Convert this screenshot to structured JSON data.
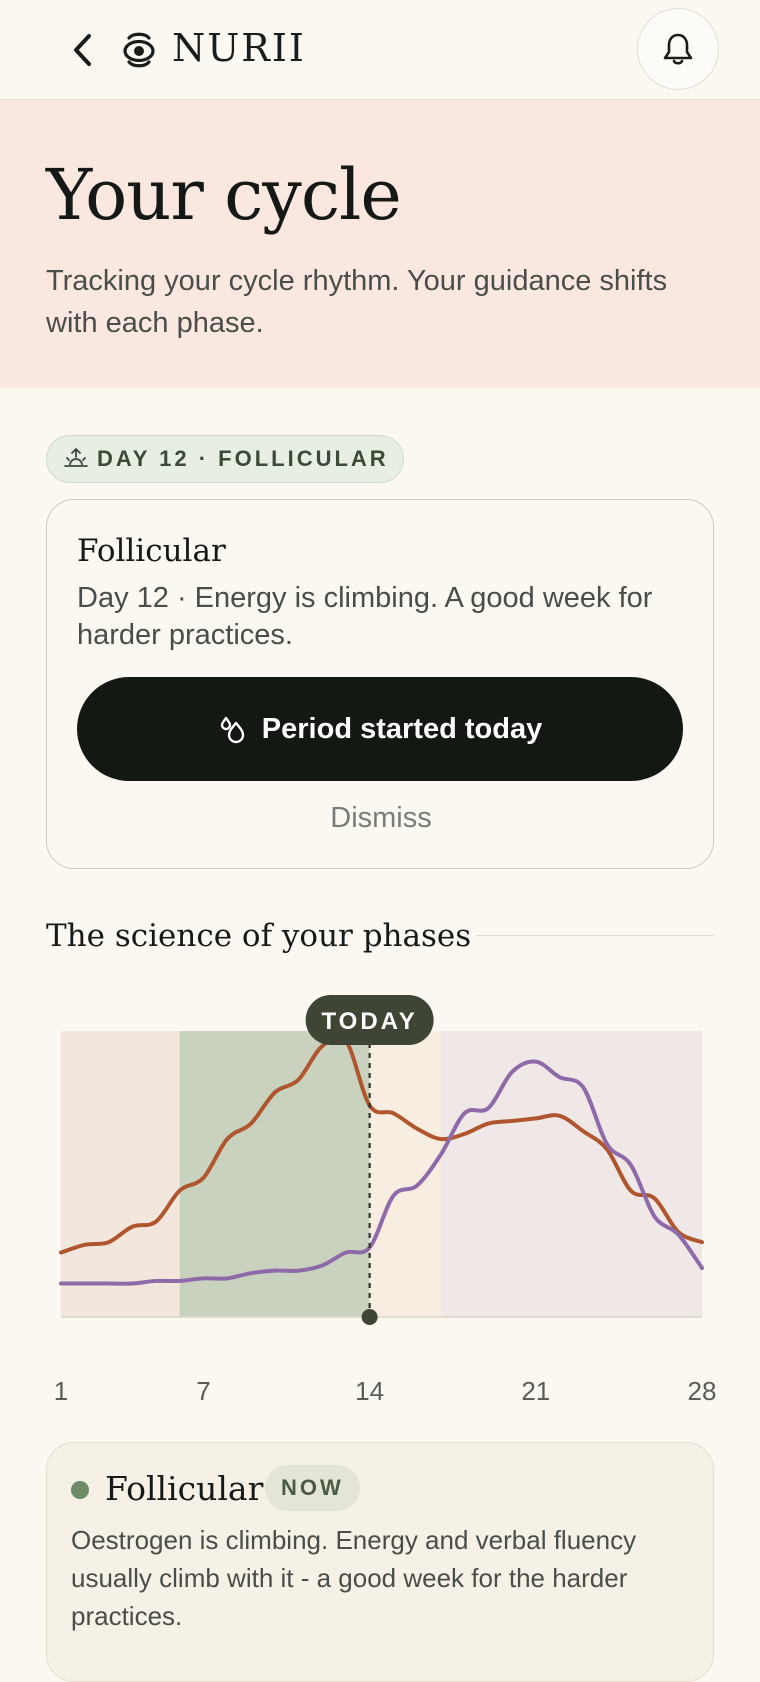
{
  "header": {
    "brand": "NURII"
  },
  "hero": {
    "title": "Your cycle",
    "subtitle": "Tracking your cycle rhythm. Your guidance shifts with each phase."
  },
  "status_pill": "DAY 12 · FOLLICULAR",
  "phase_card": {
    "title": "Follicular",
    "description": "Day 12 · Energy is climbing. A good week for harder practices.",
    "cta_label": "Period started today",
    "dismiss_label": "Dismiss"
  },
  "science": {
    "title": "The science of your phases"
  },
  "chart_data": {
    "type": "line",
    "today_label": "TODAY",
    "today_day": 14,
    "x_ticks": [
      "1",
      "7",
      "14",
      "21",
      "28"
    ],
    "xlim": [
      1,
      28
    ],
    "colors": {
      "series_1": "#b0562e",
      "series_2": "#8f6aa8",
      "today_bg": "#3f4535"
    },
    "phases": [
      {
        "start": 1,
        "end": 6,
        "color": "#f2e6dd"
      },
      {
        "start": 6,
        "end": 14,
        "color": "#c9d1bf"
      },
      {
        "start": 14,
        "end": 17,
        "color": "#f7ede0"
      },
      {
        "start": 17,
        "end": 28,
        "color": "#efe8e6"
      }
    ],
    "series": [
      {
        "x": [
          1,
          2,
          3,
          4,
          5,
          6,
          7,
          8,
          9,
          10,
          11,
          12,
          13,
          14,
          15,
          16,
          17,
          18,
          19,
          20,
          21,
          22,
          23,
          24,
          25,
          26,
          27,
          28
        ],
        "values": [
          0.18,
          0.21,
          0.22,
          0.28,
          0.3,
          0.42,
          0.47,
          0.62,
          0.68,
          0.8,
          0.85,
          0.98,
          1.0,
          0.75,
          0.72,
          0.66,
          0.62,
          0.64,
          0.68,
          0.69,
          0.7,
          0.71,
          0.65,
          0.58,
          0.42,
          0.39,
          0.26,
          0.22
        ]
      },
      {
        "x": [
          1,
          2,
          3,
          4,
          5,
          6,
          7,
          8,
          9,
          10,
          11,
          12,
          13,
          14,
          15,
          16,
          17,
          18,
          19,
          20,
          21,
          22,
          23,
          24,
          25,
          26,
          27,
          28
        ],
        "values": [
          0.06,
          0.06,
          0.06,
          0.06,
          0.07,
          0.07,
          0.08,
          0.08,
          0.1,
          0.11,
          0.11,
          0.13,
          0.18,
          0.2,
          0.4,
          0.44,
          0.56,
          0.72,
          0.74,
          0.88,
          0.92,
          0.86,
          0.82,
          0.6,
          0.52,
          0.32,
          0.25,
          0.12
        ]
      }
    ]
  },
  "phase_detail": {
    "title": "Follicular",
    "badge": "NOW",
    "description": "Oestrogen is climbing. Energy and verbal fluency usually climb with it - a good week for the harder practices."
  }
}
